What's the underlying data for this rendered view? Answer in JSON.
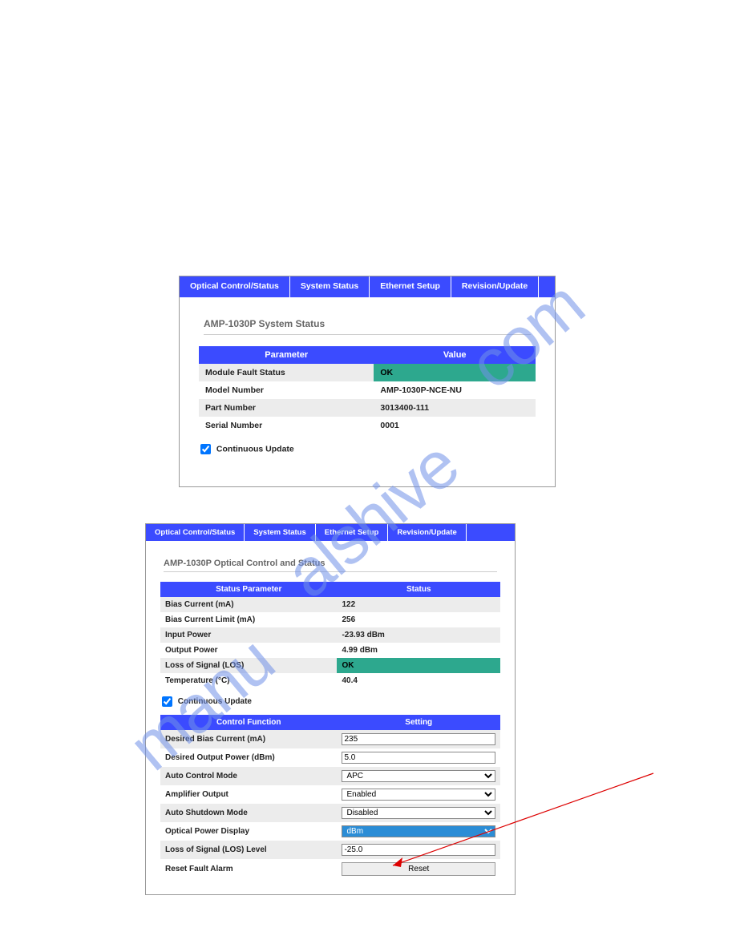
{
  "tabs": [
    "Optical Control/Status",
    "System Status",
    "Ethernet Setup",
    "Revision/Update"
  ],
  "panel1": {
    "title": "AMP-1030P System Status",
    "headers": [
      "Parameter",
      "Value"
    ],
    "rows": [
      {
        "param": "Module Fault Status",
        "value": "OK",
        "ok": true
      },
      {
        "param": "Model Number",
        "value": "AMP-1030P-NCE-NU"
      },
      {
        "param": "Part Number",
        "value": "3013400-111"
      },
      {
        "param": "Serial Number",
        "value": "0001"
      }
    ],
    "continuous": "Continuous Update"
  },
  "panel2": {
    "title": "AMP-1030P Optical Control and Status",
    "status_headers": [
      "Status Parameter",
      "Status"
    ],
    "status_rows": [
      {
        "param": "Bias Current (mA)",
        "value": "122"
      },
      {
        "param": "Bias Current Limit (mA)",
        "value": "256"
      },
      {
        "param": "Input Power",
        "value": "-23.93 dBm"
      },
      {
        "param": "Output Power",
        "value": "4.99 dBm"
      },
      {
        "param": "Loss of Signal (LOS)",
        "value": "OK",
        "ok": true
      },
      {
        "param": "Temperature (°C)",
        "value": "40.4"
      }
    ],
    "continuous": "Continuous Update",
    "ctrl_headers": [
      "Control Function",
      "Setting"
    ],
    "ctrl_rows": [
      {
        "param": "Desired Bias Current (mA)",
        "type": "text",
        "value": "235"
      },
      {
        "param": "Desired Output Power (dBm)",
        "type": "text",
        "value": "5.0"
      },
      {
        "param": "Auto Control Mode",
        "type": "select",
        "value": "APC"
      },
      {
        "param": "Amplifier Output",
        "type": "select",
        "value": "Enabled"
      },
      {
        "param": "Auto Shutdown Mode",
        "type": "select",
        "value": "Disabled"
      },
      {
        "param": "Optical Power Display",
        "type": "select-dbm",
        "value": "dBm"
      },
      {
        "param": "Loss of Signal (LOS) Level",
        "type": "text",
        "value": "-25.0"
      },
      {
        "param": "Reset Fault Alarm",
        "type": "button",
        "value": "Reset"
      }
    ]
  },
  "watermark": "manualshive.com"
}
